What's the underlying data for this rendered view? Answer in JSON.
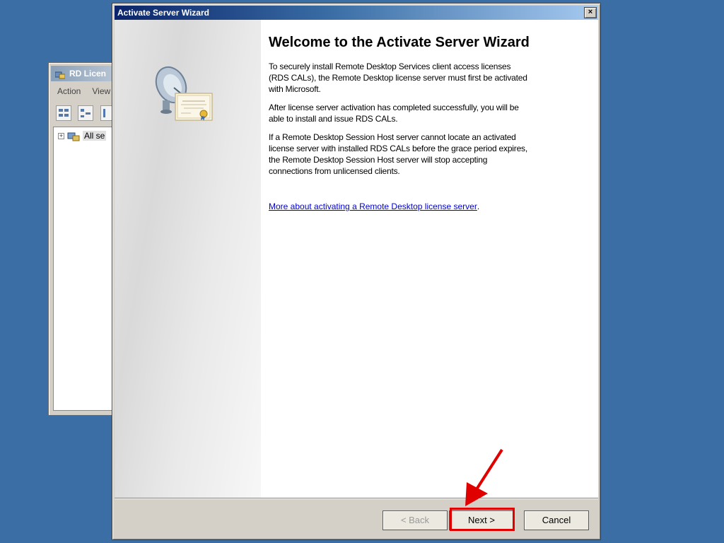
{
  "background_window": {
    "title": "RD Licen",
    "menu": [
      "Action",
      "View"
    ],
    "tree_item": "All se"
  },
  "wizard": {
    "title": "Activate Server Wizard",
    "close_glyph": "×",
    "heading": "Welcome to the Activate Server Wizard",
    "paragraphs": [
      "To securely install Remote Desktop Services client access licenses (RDS CALs), the Remote Desktop license server must first be activated with Microsoft.",
      "After license server activation has completed successfully, you will be able to install and issue RDS CALs.",
      "If a Remote Desktop Session Host server cannot locate an activated license server with installed RDS CALs before the grace period expires, the Remote Desktop Session Host server will stop accepting connections from unlicensed clients."
    ],
    "link": "More about activating a Remote Desktop license server",
    "link_suffix": ".",
    "buttons": {
      "back": "< Back",
      "next": "Next >",
      "cancel": "Cancel"
    }
  },
  "colors": {
    "desktop": "#3a6ea5",
    "highlight": "#e00000",
    "link": "#0000cc"
  },
  "icons": [
    "rd-license-manager-icon",
    "satellite-dish-icon",
    "certificate-icon",
    "red-arrow-annotation"
  ]
}
